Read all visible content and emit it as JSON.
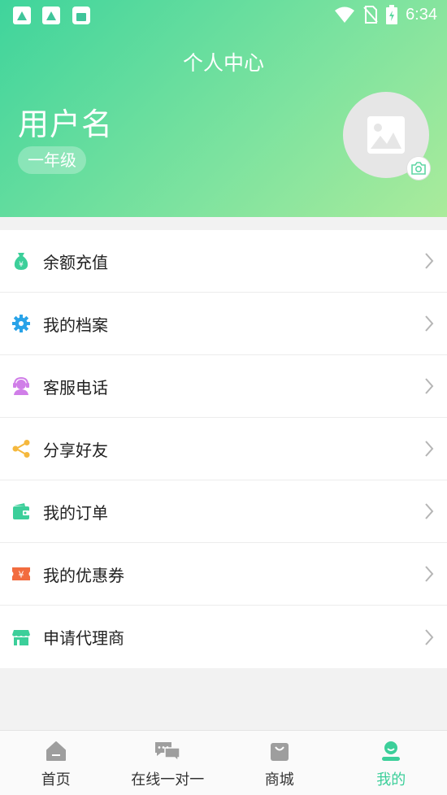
{
  "status_bar": {
    "time": "6:34"
  },
  "header": {
    "title": "个人中心",
    "username": "用户名",
    "grade": "一年级"
  },
  "menu": [
    {
      "label": "余额充值",
      "icon": "money-bag-icon"
    },
    {
      "label": "我的档案",
      "icon": "gear-icon"
    },
    {
      "label": "客服电话",
      "icon": "headset-icon"
    },
    {
      "label": "分享好友",
      "icon": "share-icon"
    },
    {
      "label": "我的订单",
      "icon": "wallet-icon"
    },
    {
      "label": "我的优惠券",
      "icon": "coupon-icon"
    },
    {
      "label": "申请代理商",
      "icon": "store-icon"
    }
  ],
  "tabs": [
    {
      "label": "首页",
      "icon": "home-icon"
    },
    {
      "label": "在线一对一",
      "icon": "chat-icon"
    },
    {
      "label": "商城",
      "icon": "shopping-bag-icon"
    },
    {
      "label": "我的",
      "icon": "profile-icon",
      "active": true
    }
  ],
  "colors": {
    "accent": "#3ccf9a",
    "header_gradient_start": "#3fd49c",
    "header_gradient_end": "#aaeb9b"
  }
}
